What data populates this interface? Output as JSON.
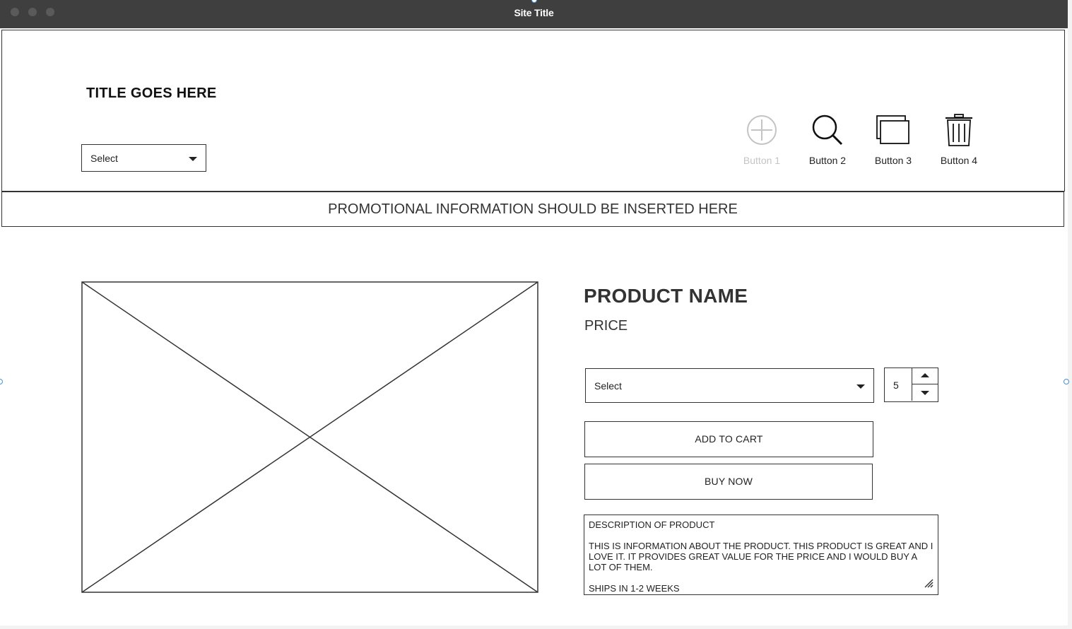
{
  "window": {
    "title": "Site Title"
  },
  "header": {
    "title": "TITLE GOES HERE",
    "select_label": "Select",
    "buttons": [
      {
        "label": "Button 1",
        "icon": "plus-circle-icon",
        "disabled": true
      },
      {
        "label": "Button 2",
        "icon": "search-icon",
        "disabled": false
      },
      {
        "label": "Button 3",
        "icon": "windows-icon",
        "disabled": false
      },
      {
        "label": "Button 4",
        "icon": "trash-icon",
        "disabled": false
      }
    ]
  },
  "promo": {
    "text": "PROMOTIONAL INFORMATION SHOULD BE INSERTED HERE"
  },
  "product": {
    "name": "PRODUCT NAME",
    "price": "PRICE",
    "variant_select_label": "Select",
    "quantity": "5",
    "add_to_cart_label": "ADD TO CART",
    "buy_now_label": "BUY NOW",
    "description": {
      "heading": "DESCRIPTION OF PRODUCT",
      "body": "THIS IS INFORMATION ABOUT THE PRODUCT. THIS PRODUCT IS GREAT AND I LOVE IT. IT PROVIDES GREAT VALUE FOR THE PRICE AND I WOULD BUY A LOT OF THEM.",
      "shipping": "SHIPS IN 1-2 WEEKS"
    }
  },
  "colors": {
    "titlebar": "#3f3f3f",
    "border": "#333333",
    "disabled": "#c4c4c4"
  }
}
